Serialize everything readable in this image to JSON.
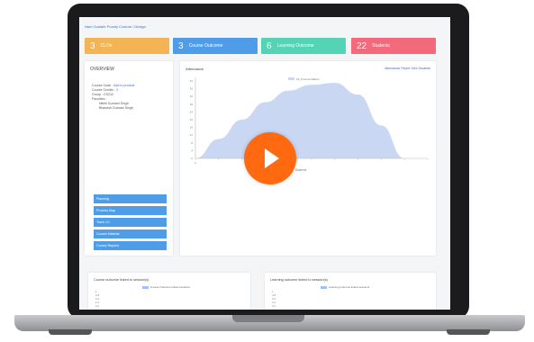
{
  "breadcrumb": "Nam Gustafe Ponoty Custom / Design",
  "stats": [
    {
      "num": "3",
      "label": "CLOs"
    },
    {
      "num": "3",
      "label": "Course Outcome"
    },
    {
      "num": "6",
      "label": "Learning Outcome"
    },
    {
      "num": "22",
      "label": "Students"
    }
  ],
  "overview": {
    "title": "OVERVIEW",
    "course_code_label": "Course Code :",
    "course_code_value": "Add to product",
    "course_credits_label": "Course Credits :",
    "course_credits_value": "3",
    "group_label": "Group :",
    "group_value": "CS212",
    "faculties_label": "Faculties :",
    "faculty_1": "Nikhil Gurnani Singh",
    "faculty_2": "Bhavesh Gurnani Singh",
    "buttons": [
      "Planning",
      "Process Map",
      "Track LO",
      "Course Material",
      "Course Reports"
    ]
  },
  "graph": {
    "title": "Attendance",
    "links": "Attendance Report   View Students"
  },
  "chart_data": {
    "type": "area",
    "title": "",
    "xlabel": "Students",
    "ylabel": "",
    "series": [
      {
        "name": "Fly (Course Marks)",
        "color": "#c9d7f3"
      }
    ],
    "x": [
      0,
      1,
      2,
      3,
      4,
      5,
      6,
      7,
      8,
      9,
      10
    ],
    "values": [
      0,
      10,
      20,
      29,
      35,
      38,
      39,
      33,
      17,
      0,
      0
    ],
    "ylim": [
      0,
      40
    ],
    "y_ticks": [
      "40",
      "36",
      "32",
      "28",
      "24",
      "20",
      "16",
      "12",
      "8",
      "4",
      "0"
    ],
    "x_ticks": [
      "0",
      "",
      "",
      "",
      "",
      "",
      "",
      "",
      "",
      "",
      ""
    ],
    "grid": false,
    "legend": "top-center"
  },
  "outcome1": {
    "title": "Course outcome linked to session(s)",
    "legend": "Course Outcome linked sessions",
    "ticks": [
      "1",
      "0.8",
      "0.6",
      "0.4",
      "0.2"
    ]
  },
  "outcome2": {
    "title": "Learning outcome linked to session(s)",
    "legend": "Learning outcome linked sessions",
    "ticks": [
      "1",
      "0.8",
      "0.6",
      "0.4",
      "0.2"
    ]
  },
  "play_icon": "play-icon"
}
